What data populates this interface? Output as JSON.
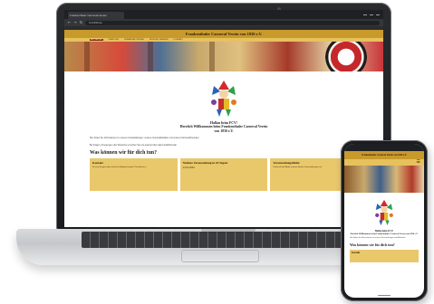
{
  "browser": {
    "tab_title": "Frankenthaler Carneval-Verein",
    "url": "fcv1830.de"
  },
  "site": {
    "title": "Frankenthaler Carneval Verein von 1830 e.V.",
    "nav": [
      "AKTUELLES",
      "ÜBER UNS",
      "VERANSTALTUNGEN",
      "MITGLIED WERDEN",
      "KONTAKT"
    ],
    "greeting": "Hallau beim FCV!",
    "welcome_line1": "Herzlich Willkommen beim Frankenthaler Carneval Verein",
    "welcome_line2": "von 1830 e.V.",
    "intro": "Hier finden Sie Informationen zu unseren Veranstaltungen, unseren Vereinsaktivitäten und unseren Karnevalsfreunden.",
    "intro2": "Bei Fragen, Anregungen oder Wünschen erreichen Sie uns jederzeit über das Kontaktformular.",
    "section_heading": "Was können wir für dich tun?",
    "cards": [
      {
        "title": "Kontakt",
        "text": "Du hast Fragen oder möchtest Mitglied werden? Schreib uns!",
        "date": ""
      },
      {
        "title": "Nächste Veranstaltung in 18 Tagen!",
        "text": "",
        "date": "14.01.2023"
      },
      {
        "title": "Veranstaltungsbilder",
        "text": "Schau dir die Bilder unserer letzten Veranstaltungen an!",
        "date": ""
      }
    ]
  },
  "phone": {
    "title": "Frankenthaler Carneval Verein von 1830 e.V.",
    "menu_icon": "hamburger-menu-icon",
    "greeting": "Hallau beim FCV!",
    "welcome": "Herzlich Willkommen beim Frankenthaler Carneval Verein von 1830 e.V.",
    "intro": "Hier finden Sie Informationen zu unseren Veranstaltungen und Aktivitäten.",
    "section_heading": "Was können wir für dich tun?",
    "card_title": "Kontakt"
  },
  "colors": {
    "header_gold": "#c89a2c",
    "nav_gold": "#e7c15c",
    "card_gold": "#e9c86b",
    "accent_red": "#8b2418"
  }
}
